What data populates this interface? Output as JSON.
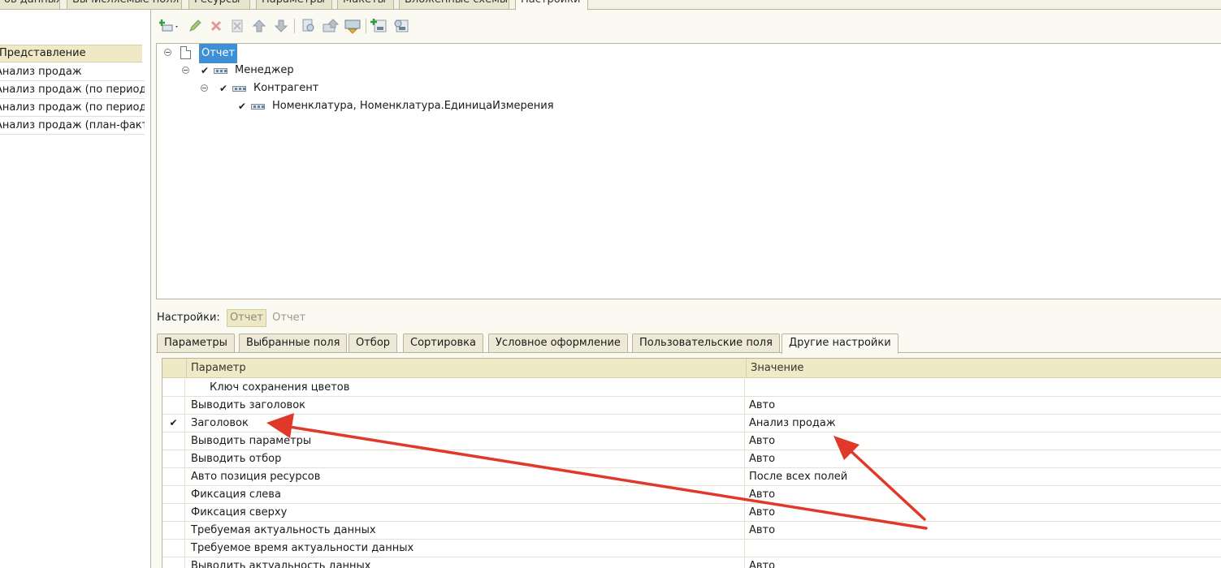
{
  "top_tabs": [
    {
      "label": "ов данных",
      "active": false
    },
    {
      "label": "Вычисляемые поля",
      "active": false
    },
    {
      "label": "Ресурсы",
      "active": false
    },
    {
      "label": "Параметры",
      "active": false
    },
    {
      "label": "Макеты",
      "active": false
    },
    {
      "label": "Вложенные схемы",
      "active": false
    },
    {
      "label": "Настройки",
      "active": true
    }
  ],
  "left_panel": {
    "header": "Представление",
    "rows": [
      "Анализ продаж",
      "Анализ продаж (по период...",
      "Анализ продаж (по период...",
      "Анализ продаж (план-факт)"
    ]
  },
  "toolbar": {
    "buttons": [
      "add-icon",
      "edit-icon",
      "delete-icon",
      "copy-icon",
      "move-up-icon",
      "move-down-icon",
      "find-icon",
      "group-icon",
      "ungroup-icon",
      "settings-icon",
      "other-settings-icon"
    ]
  },
  "tree": {
    "root": "Отчет",
    "manager": "Менеджер",
    "contractor": "Контрагент",
    "nomenclature": "Номенклатура, Номенклатура.ЕдиницаИзмерения"
  },
  "settings": {
    "label": "Настройки:",
    "chip": "Отчет",
    "plain": "Отчет"
  },
  "bottom_tabs": [
    {
      "label": "Параметры",
      "active": false
    },
    {
      "label": "Выбранные поля",
      "active": false
    },
    {
      "label": "Отбор",
      "active": false
    },
    {
      "label": "Сортировка",
      "active": false
    },
    {
      "label": "Условное оформление",
      "active": false
    },
    {
      "label": "Пользовательские поля",
      "active": false
    },
    {
      "label": "Другие настройки",
      "active": true
    }
  ],
  "grid": {
    "col_param": "Параметр",
    "col_value": "Значение",
    "rows": [
      {
        "checked": false,
        "param": "Ключ сохранения цветов",
        "value": "",
        "indent": true
      },
      {
        "checked": false,
        "param": "Выводить заголовок",
        "value": "Авто",
        "indent": false
      },
      {
        "checked": true,
        "param": "Заголовок",
        "value": "Анализ продаж",
        "indent": false
      },
      {
        "checked": false,
        "param": "Выводить параметры",
        "value": "Авто",
        "indent": false
      },
      {
        "checked": false,
        "param": "Выводить отбор",
        "value": "Авто",
        "indent": false
      },
      {
        "checked": false,
        "param": "Авто позиция ресурсов",
        "value": "После всех полей",
        "indent": false
      },
      {
        "checked": false,
        "param": "Фиксация слева",
        "value": "Авто",
        "indent": false
      },
      {
        "checked": false,
        "param": "Фиксация сверху",
        "value": "Авто",
        "indent": false
      },
      {
        "checked": false,
        "param": "Требуемая актуальность данных",
        "value": "Авто",
        "indent": false
      },
      {
        "checked": false,
        "param": "Требуемое время актуальности данных",
        "value": "",
        "indent": false
      },
      {
        "checked": false,
        "param": "Выводить актуальность данных",
        "value": "Авто",
        "indent": false
      }
    ]
  },
  "colors": {
    "accent_selection": "#3d8fd6",
    "annotation_arrow": "#e0392b",
    "header_bg": "#f0e9c6"
  }
}
